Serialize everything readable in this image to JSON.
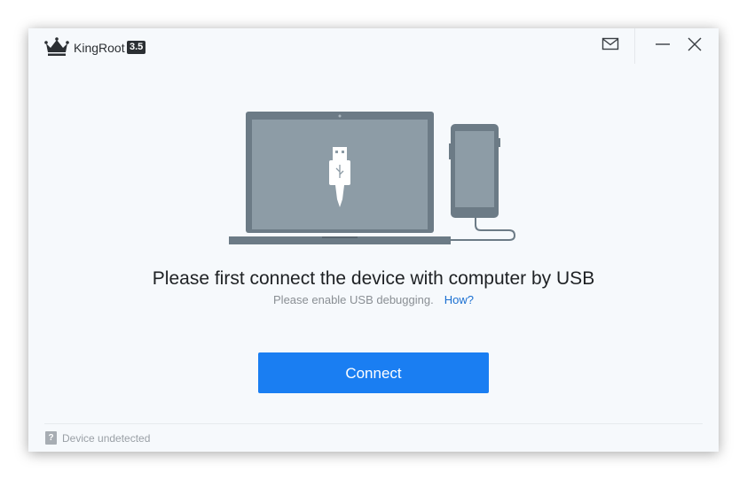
{
  "app": {
    "name": "KingRoot",
    "version": "3.5"
  },
  "titlebar": {
    "mail_icon": "mail-icon",
    "minimize_icon": "minimize-icon",
    "close_icon": "close-icon"
  },
  "main": {
    "illustration_icon": "laptop-phone-usb-icon",
    "headline": "Please first connect the device with computer by USB",
    "subline": "Please enable USB debugging.",
    "help_link": "How?",
    "connect_label": "Connect"
  },
  "status": {
    "icon_glyph": "?",
    "text": "Device undetected"
  },
  "colors": {
    "accent": "#1a7ef2",
    "link": "#1a6fd1",
    "illustration": "#6c7b86",
    "illustration_screen": "#8d9ca6"
  }
}
